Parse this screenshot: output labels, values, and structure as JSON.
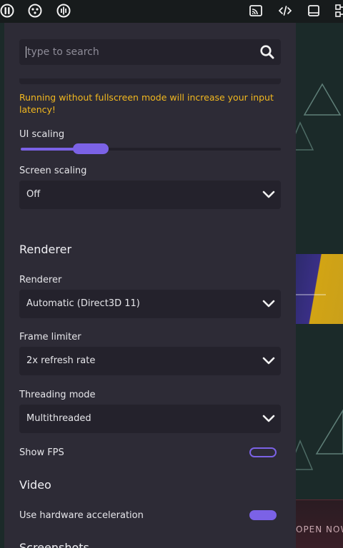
{
  "colors": {
    "accent": "#7b62e6",
    "panel": "#2d2b36",
    "field": "#24222c",
    "warning": "#f2b81f",
    "background": "#1b2a29"
  },
  "topbar": {
    "icons": [
      "emulator-logo-icon",
      "gamepad-icon",
      "audio-wave-icon",
      "cast-icon",
      "code-icon",
      "window-icon",
      "network-icon"
    ]
  },
  "search": {
    "placeholder": "type to search",
    "value": ""
  },
  "warning_text": "Running without fullscreen mode will increase your input latency!",
  "ui_scaling": {
    "label": "UI scaling",
    "value_fraction": 0.27
  },
  "screen_scaling": {
    "label": "Screen scaling",
    "value": "Off"
  },
  "renderer_section": {
    "title": "Renderer"
  },
  "renderer": {
    "label": "Renderer",
    "value": "Automatic (Direct3D 11)"
  },
  "frame_limiter": {
    "label": "Frame limiter",
    "value": "2x refresh rate"
  },
  "threading_mode": {
    "label": "Threading mode",
    "value": "Multithreaded"
  },
  "show_fps": {
    "label": "Show FPS",
    "enabled": false
  },
  "video_section": {
    "title": "Video"
  },
  "hardware_acceleration": {
    "label": "Use hardware acceleration",
    "enabled": true
  },
  "screenshots_section": {
    "title": "Screenshots"
  },
  "background": {
    "promo_text": "OPEN NOW"
  }
}
